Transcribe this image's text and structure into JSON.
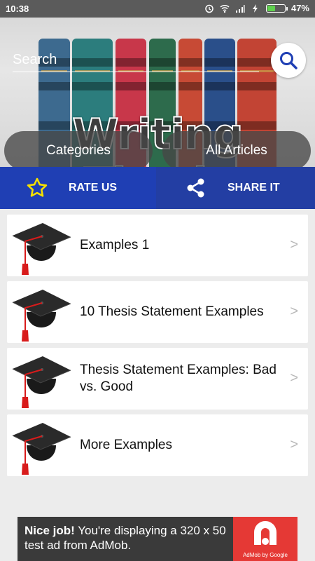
{
  "status": {
    "time": "10:38",
    "battery": "47%",
    "battery_level": 0.47
  },
  "search": {
    "placeholder": "Search"
  },
  "banner": {
    "title": "Writing Thesis"
  },
  "header_tabs": [
    {
      "label": "Categories"
    },
    {
      "label": "All Articles"
    }
  ],
  "actions": {
    "rate_label": "RATE US",
    "share_label": "SHARE IT"
  },
  "articles": [
    {
      "title": "Examples 1",
      "icon": "graduation-cap-icon",
      "chevron": ">"
    },
    {
      "title": "10 Thesis Statement Examples",
      "icon": "graduation-cap-icon",
      "chevron": ">"
    },
    {
      "title": "Thesis Statement Examples: Bad vs. Good",
      "icon": "graduation-cap-icon",
      "chevron": ">"
    },
    {
      "title": "More Examples",
      "icon": "graduation-cap-icon",
      "chevron": ">"
    }
  ],
  "ad": {
    "headline": "Nice job!",
    "body": " You're displaying a 320 x 50 test ad from AdMob.",
    "brand": "AdMob by Google"
  },
  "colors": {
    "accent": "#1f3fb4",
    "status_bar": "#5b5b5b",
    "background": "#ececec",
    "ad_red": "#e53935"
  }
}
